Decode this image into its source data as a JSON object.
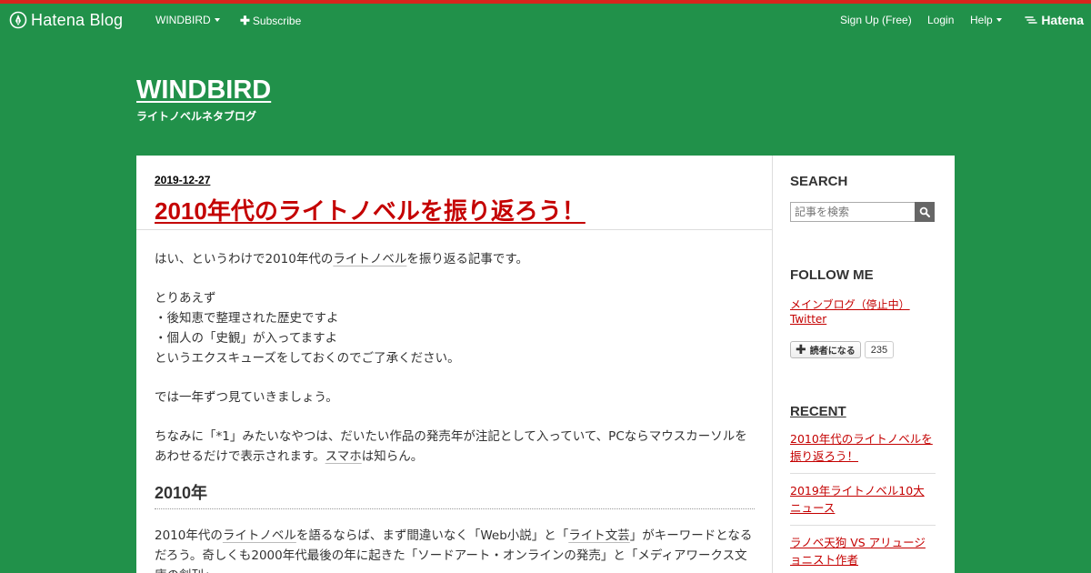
{
  "topbar": {
    "logo_text": "Hatena Blog",
    "blog_menu": "WINDBIRD",
    "subscribe": "Subscribe",
    "signup": "Sign Up (Free)",
    "login": "Login",
    "help": "Help",
    "hatena": "Hatena"
  },
  "blog": {
    "title": "WINDBIRD",
    "description": "ライトノベルネタブログ"
  },
  "entry": {
    "date": "2019-12-27",
    "title": "2010年代のライトノベルを振り返ろう！",
    "p1_a": "はい、というわけで2010年代の",
    "p1_kw": "ライトノベル",
    "p1_b": "を振り返る記事です。",
    "p2_l1": "とりあえず",
    "p2_l2": "・後知恵で整理された歴史ですよ",
    "p2_l3": "・個人の「史観」が入ってますよ",
    "p2_l4": "というエクスキューズをしておくのでご了承ください。",
    "p3": "では一年ずつ見ていきましょう。",
    "p4_a": "ちなみに「*1」みたいなやつは、だいたい作品の発売年が注記として入っていて、PCならマウスカーソルをあわせるだけで表示されます。",
    "p4_kw": "スマホ",
    "p4_b": "は知らん。",
    "h3": "2010年",
    "p5_a": "2010年代の",
    "p5_kw1": "ライトノベル",
    "p5_b": "を語るならば、まず間違いなく「Web小説」と「",
    "p5_kw2": "ライト文芸",
    "p5_c": "」がキーワードとなるだろう。奇しくも2000年代最後の年に起きた「ソードアート・オンラインの発売」と「メディアワークス文庫の創刊」"
  },
  "sidebar": {
    "search_title": "SEARCH",
    "search_placeholder": "記事を検索",
    "follow_title": "FOLLOW ME",
    "follow_links": [
      "メインブログ（停止中）",
      "Twitter"
    ],
    "subscribe_label": "読者になる",
    "subscriber_count": "235",
    "recent_title": "RECENT",
    "recent": [
      "2010年代のライトノベルを振り返ろう！",
      "2019年ライトノベル10大ニュース",
      "ラノベ天狗 VS アリュージョニスト作者"
    ]
  }
}
